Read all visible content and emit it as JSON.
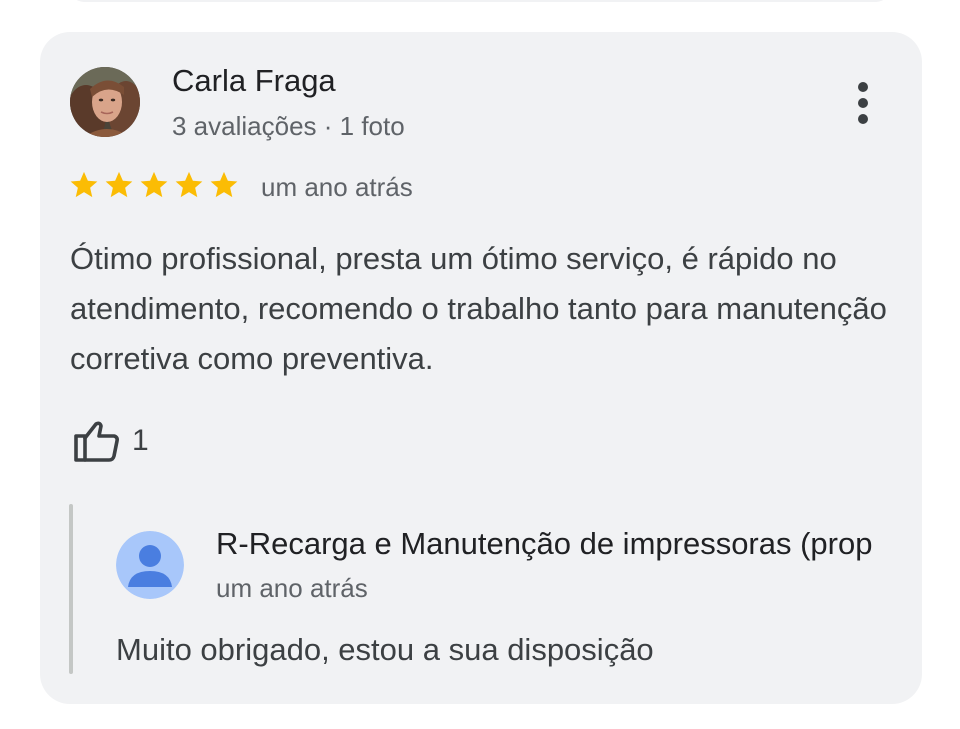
{
  "review": {
    "author_name": "Carla Fraga",
    "author_meta": "3 avaliações · 1 foto",
    "rating": 5,
    "rating_max": 5,
    "time": "um ano atrás",
    "text": "Ótimo profissional, presta um ótimo serviço, é rápido no atendimento, recomendo o trabalho tanto para manutenção corretiva como preventiva.",
    "likes": "1",
    "star_color": "#fbbc04"
  },
  "owner_reply": {
    "owner_name": "R-Recarga e Manutenção de impressoras (prop",
    "time": "um ano atrás",
    "text": "Muito obrigado, estou a sua disposição",
    "avatar_color": "#a8c7fa",
    "avatar_figure_color": "#4a7ee0"
  },
  "icons": {
    "more": "more-vert-icon",
    "like": "thumb-up-icon",
    "star": "star-icon"
  }
}
